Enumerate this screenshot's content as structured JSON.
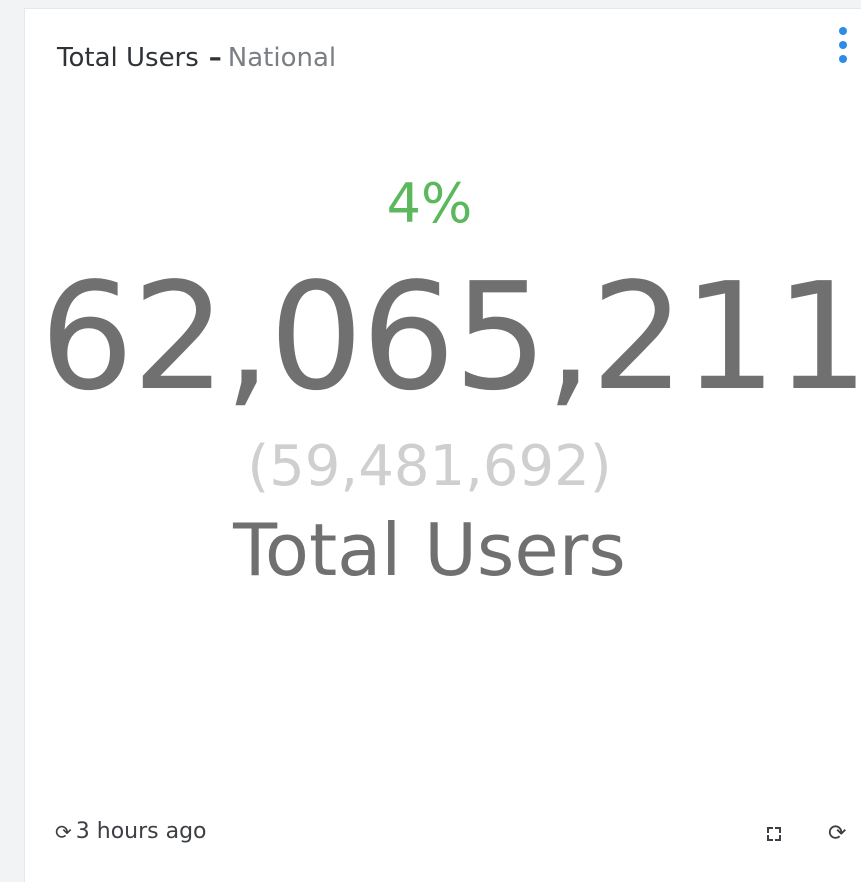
{
  "widget": {
    "title": "Total Users",
    "separator": "–",
    "subtitle": "National",
    "menu_icon": "kebab-menu-icon",
    "accent_color": "#2d8ce6"
  },
  "metric": {
    "change": "4%",
    "change_color": "#5cb85c",
    "value": "62,065,211",
    "previous_value": "(59,481,692)",
    "label": "Total Users"
  },
  "footer": {
    "refresh_glyph": "⟳",
    "last_updated": "3 hours ago",
    "expand_icon": "expand-icon",
    "refresh_icon": "refresh-icon"
  }
}
